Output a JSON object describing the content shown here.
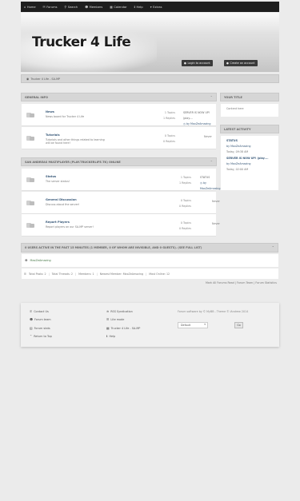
{
  "nav": {
    "items": [
      {
        "icon": "home-icon",
        "glyph": "⌂",
        "label": "Home"
      },
      {
        "icon": "forums-icon",
        "glyph": "✉",
        "label": "Forums"
      },
      {
        "icon": "search-icon",
        "glyph": "⚲",
        "label": "Search"
      },
      {
        "icon": "members-icon",
        "glyph": "☻",
        "label": "Members"
      },
      {
        "icon": "calendar-icon",
        "glyph": "▦",
        "label": "Calendar"
      },
      {
        "icon": "help-icon",
        "glyph": "ℹ",
        "label": "Help"
      },
      {
        "icon": "extras-icon",
        "glyph": "▾",
        "label": "Extras"
      }
    ]
  },
  "banner": {
    "logo_text": "Trucker 4 Life",
    "login_label": "Login to account",
    "create_label": "Create an account"
  },
  "breadcrumb": {
    "label": "Trucker 4 Life - SA-MP"
  },
  "general": {
    "title": "GENERAL INFO",
    "forums": [
      {
        "name": "News",
        "desc": "News board for Trucker 4 Life",
        "topics": "1 Topics",
        "replies": "1 Replies",
        "last_title": "SERVER IS NOW UP! (play....",
        "last_by": "by MaxZeAmazing"
      },
      {
        "name": "Tutorials",
        "desc": "Tutorials and other things related to learning",
        "desc2": "will be found here!",
        "topics": "0 Topics",
        "replies": "0 Replies",
        "last": "Never"
      }
    ]
  },
  "samp": {
    "title": "SAN ANDREAS MULTIPLAYER (PLAY.TRUCKERLIFE.TK) ONLINE",
    "forums": [
      {
        "name": "Status",
        "desc": "The server status!",
        "topics": "1 Topics",
        "replies": "1 Replies",
        "last_title": "STATUS",
        "last_by": "by MaxZeAmazing"
      },
      {
        "name": "General Discussion",
        "desc": "Discuss about the server!",
        "topics": "0 Topics",
        "replies": "0 Replies",
        "last": "Never"
      },
      {
        "name": "Report Players",
        "desc": "Report players on our SA-MP server!",
        "topics": "0 Topics",
        "replies": "0 Replies",
        "last": "Never"
      }
    ]
  },
  "sidebar": {
    "your_title": "YOUR TITLE",
    "your_body": "Content here",
    "latest_title": "LATEST ACTIVITY",
    "activity": [
      {
        "title": "STATUS",
        "by": "by MaxZeAmazing",
        "time": "Today, 09:38 AM"
      },
      {
        "title": "SERVER IS NOW UP! (play....",
        "by": "by MaxZeAmazing",
        "time": "Today, 02:00 AM"
      }
    ]
  },
  "online": {
    "title": "0 USERS ACTIVE IN THE PAST 15 MINUTES (1 MEMBER, 0 OF WHOM ARE INVISIBLE, AND 0 GUESTS). (SEE FULL LIST)",
    "user": "MaxZeAmazing",
    "stats": [
      "Total Posts: 2",
      "Total Threads: 2",
      "Members: 1",
      "Newest Member: MaxZeAmazing",
      "Most Online: 12"
    ],
    "links": [
      "Mark All Forums Read",
      "Forum Team",
      "Forum Statistics"
    ]
  },
  "footer": {
    "links_col1": [
      "Contact Us",
      "Forum team",
      "Forum stats",
      "Return to Top"
    ],
    "links_col2": [
      "RSS Syndication",
      "Lite mode",
      "Trucker 4 Life - SA-MP",
      "Help"
    ],
    "credit": "Forum software by © MyBB - Theme © iAndrew 2014",
    "theme_value": "Default",
    "go_label": "Go"
  },
  "colors": {
    "nav_bg": "#1e1e1e",
    "link": "#3a5a7a",
    "online_user": "#4a7a4a"
  }
}
